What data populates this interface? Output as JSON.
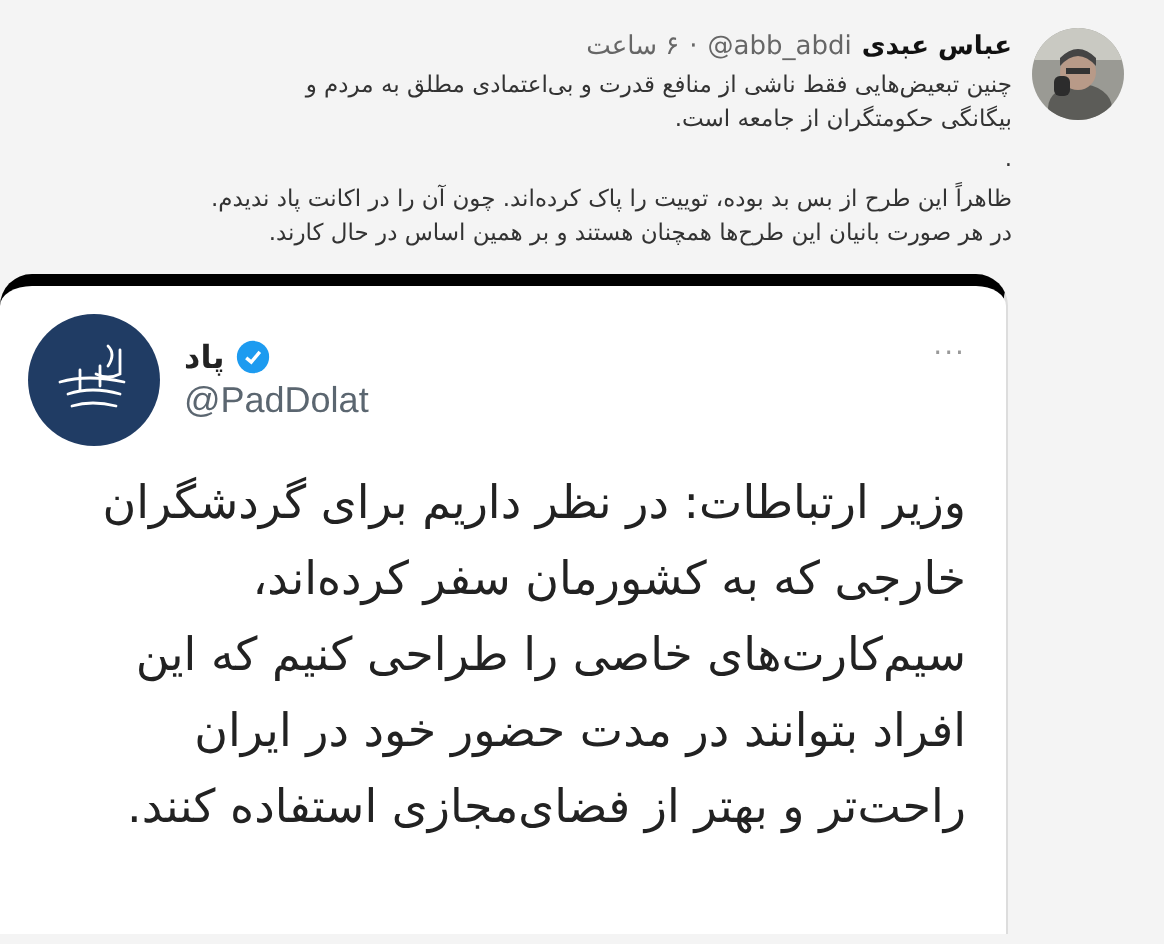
{
  "tweet": {
    "avatar": {
      "kind": "picture"
    },
    "name": "عباس عبدی",
    "handle": "@abb_abdi",
    "separator": "·",
    "time": "۶ ساعت",
    "paragraphs": [
      [
        "چنین تبعیض‌هایی فقط ناشی از منافع قدرت و بی‌اعتمادی مطلق به مردم و",
        "بیگانگی حکومتگران از جامعه است."
      ],
      [
        "."
      ],
      [
        "ظاهراً این طرح از بس بد بوده، توییت را پاک کرده‌اند. چون آن را در اکانت پاد ندیدم.",
        "در هر صورت بانیان این طرح‌ها همچنان هستند و بر همین اساس در حال کارند."
      ]
    ]
  },
  "quoted": {
    "name": "پاد",
    "verified": true,
    "handle": "@PadDolat",
    "more": "···",
    "lines": [
      "وزیر ارتباطات: در نظر داریم برای گردشگران",
      "خارجی که به کشورمان سفر کرده‌اند،",
      "سیم‌کارت‌های خاصی را طراحی کنیم که این",
      "افراد بتوانند در مدت حضور خود در ایران",
      "راحت‌تر و بهتر از فضای‌مجازی استفاده کنند."
    ]
  }
}
